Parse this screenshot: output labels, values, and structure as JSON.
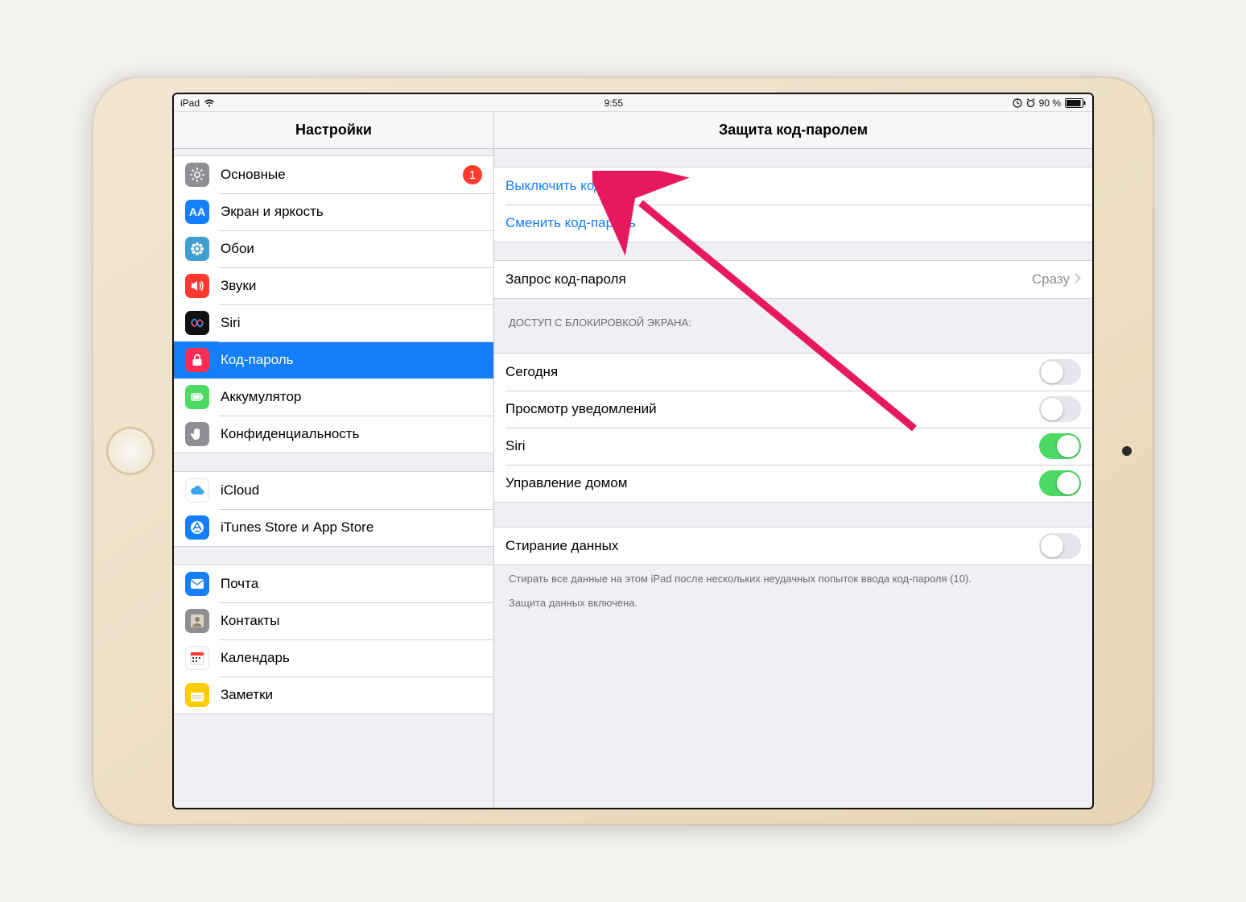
{
  "statusbar": {
    "carrier": "iPad",
    "time": "9:55",
    "battery_pct": "90 %"
  },
  "sidebar": {
    "title": "Настройки",
    "groups": [
      {
        "items": [
          {
            "id": "general",
            "label": "Основные",
            "icon": "gear",
            "bg": "bg-gray",
            "badge": "1"
          },
          {
            "id": "display",
            "label": "Экран и яркость",
            "icon": "AA",
            "bg": "bg-blue"
          },
          {
            "id": "wallpaper",
            "label": "Обои",
            "icon": "flower",
            "bg": "bg-teal"
          },
          {
            "id": "sounds",
            "label": "Звуки",
            "icon": "speaker",
            "bg": "bg-red"
          },
          {
            "id": "siri",
            "label": "Siri",
            "icon": "siri",
            "bg": "bg-black"
          },
          {
            "id": "passcode",
            "label": "Код-пароль",
            "icon": "lock",
            "bg": "bg-pink",
            "selected": true
          },
          {
            "id": "battery",
            "label": "Аккумулятор",
            "icon": "battery",
            "bg": "bg-green"
          },
          {
            "id": "privacy",
            "label": "Конфиденциальность",
            "icon": "hand",
            "bg": "bg-gray"
          }
        ]
      },
      {
        "items": [
          {
            "id": "icloud",
            "label": "iCloud",
            "icon": "cloud",
            "bg": "bg-white",
            "account": true
          },
          {
            "id": "itunes",
            "label": "iTunes Store и App Store",
            "icon": "appstore",
            "bg": "bg-blue"
          }
        ]
      },
      {
        "items": [
          {
            "id": "mail",
            "label": "Почта",
            "icon": "mail",
            "bg": "bg-blue"
          },
          {
            "id": "contacts",
            "label": "Контакты",
            "icon": "contact",
            "bg": "bg-gray"
          },
          {
            "id": "calendar",
            "label": "Календарь",
            "icon": "calendar",
            "bg": "bg-white"
          },
          {
            "id": "notes",
            "label": "Заметки",
            "icon": "notes",
            "bg": "bg-yellow"
          }
        ]
      }
    ]
  },
  "detail": {
    "title": "Защита код-паролем",
    "actions": {
      "turn_off": "Выключить код-пароль",
      "change": "Сменить код-пароль"
    },
    "require": {
      "label": "Запрос код-пароля",
      "value": "Сразу"
    },
    "lockscreen_header": "ДОСТУП С БЛОКИРОВКОЙ ЭКРАНА:",
    "lockscreen": [
      {
        "id": "today",
        "label": "Сегодня",
        "on": false
      },
      {
        "id": "notif",
        "label": "Просмотр уведомлений",
        "on": false
      },
      {
        "id": "siri",
        "label": "Siri",
        "on": true
      },
      {
        "id": "home",
        "label": "Управление домом",
        "on": true
      }
    ],
    "erase": {
      "label": "Стирание данных",
      "on": false,
      "footer1": "Стирать все данные на этом iPad после нескольких неудачных попыток ввода код-пароля (10).",
      "footer2": "Защита данных включена."
    }
  }
}
